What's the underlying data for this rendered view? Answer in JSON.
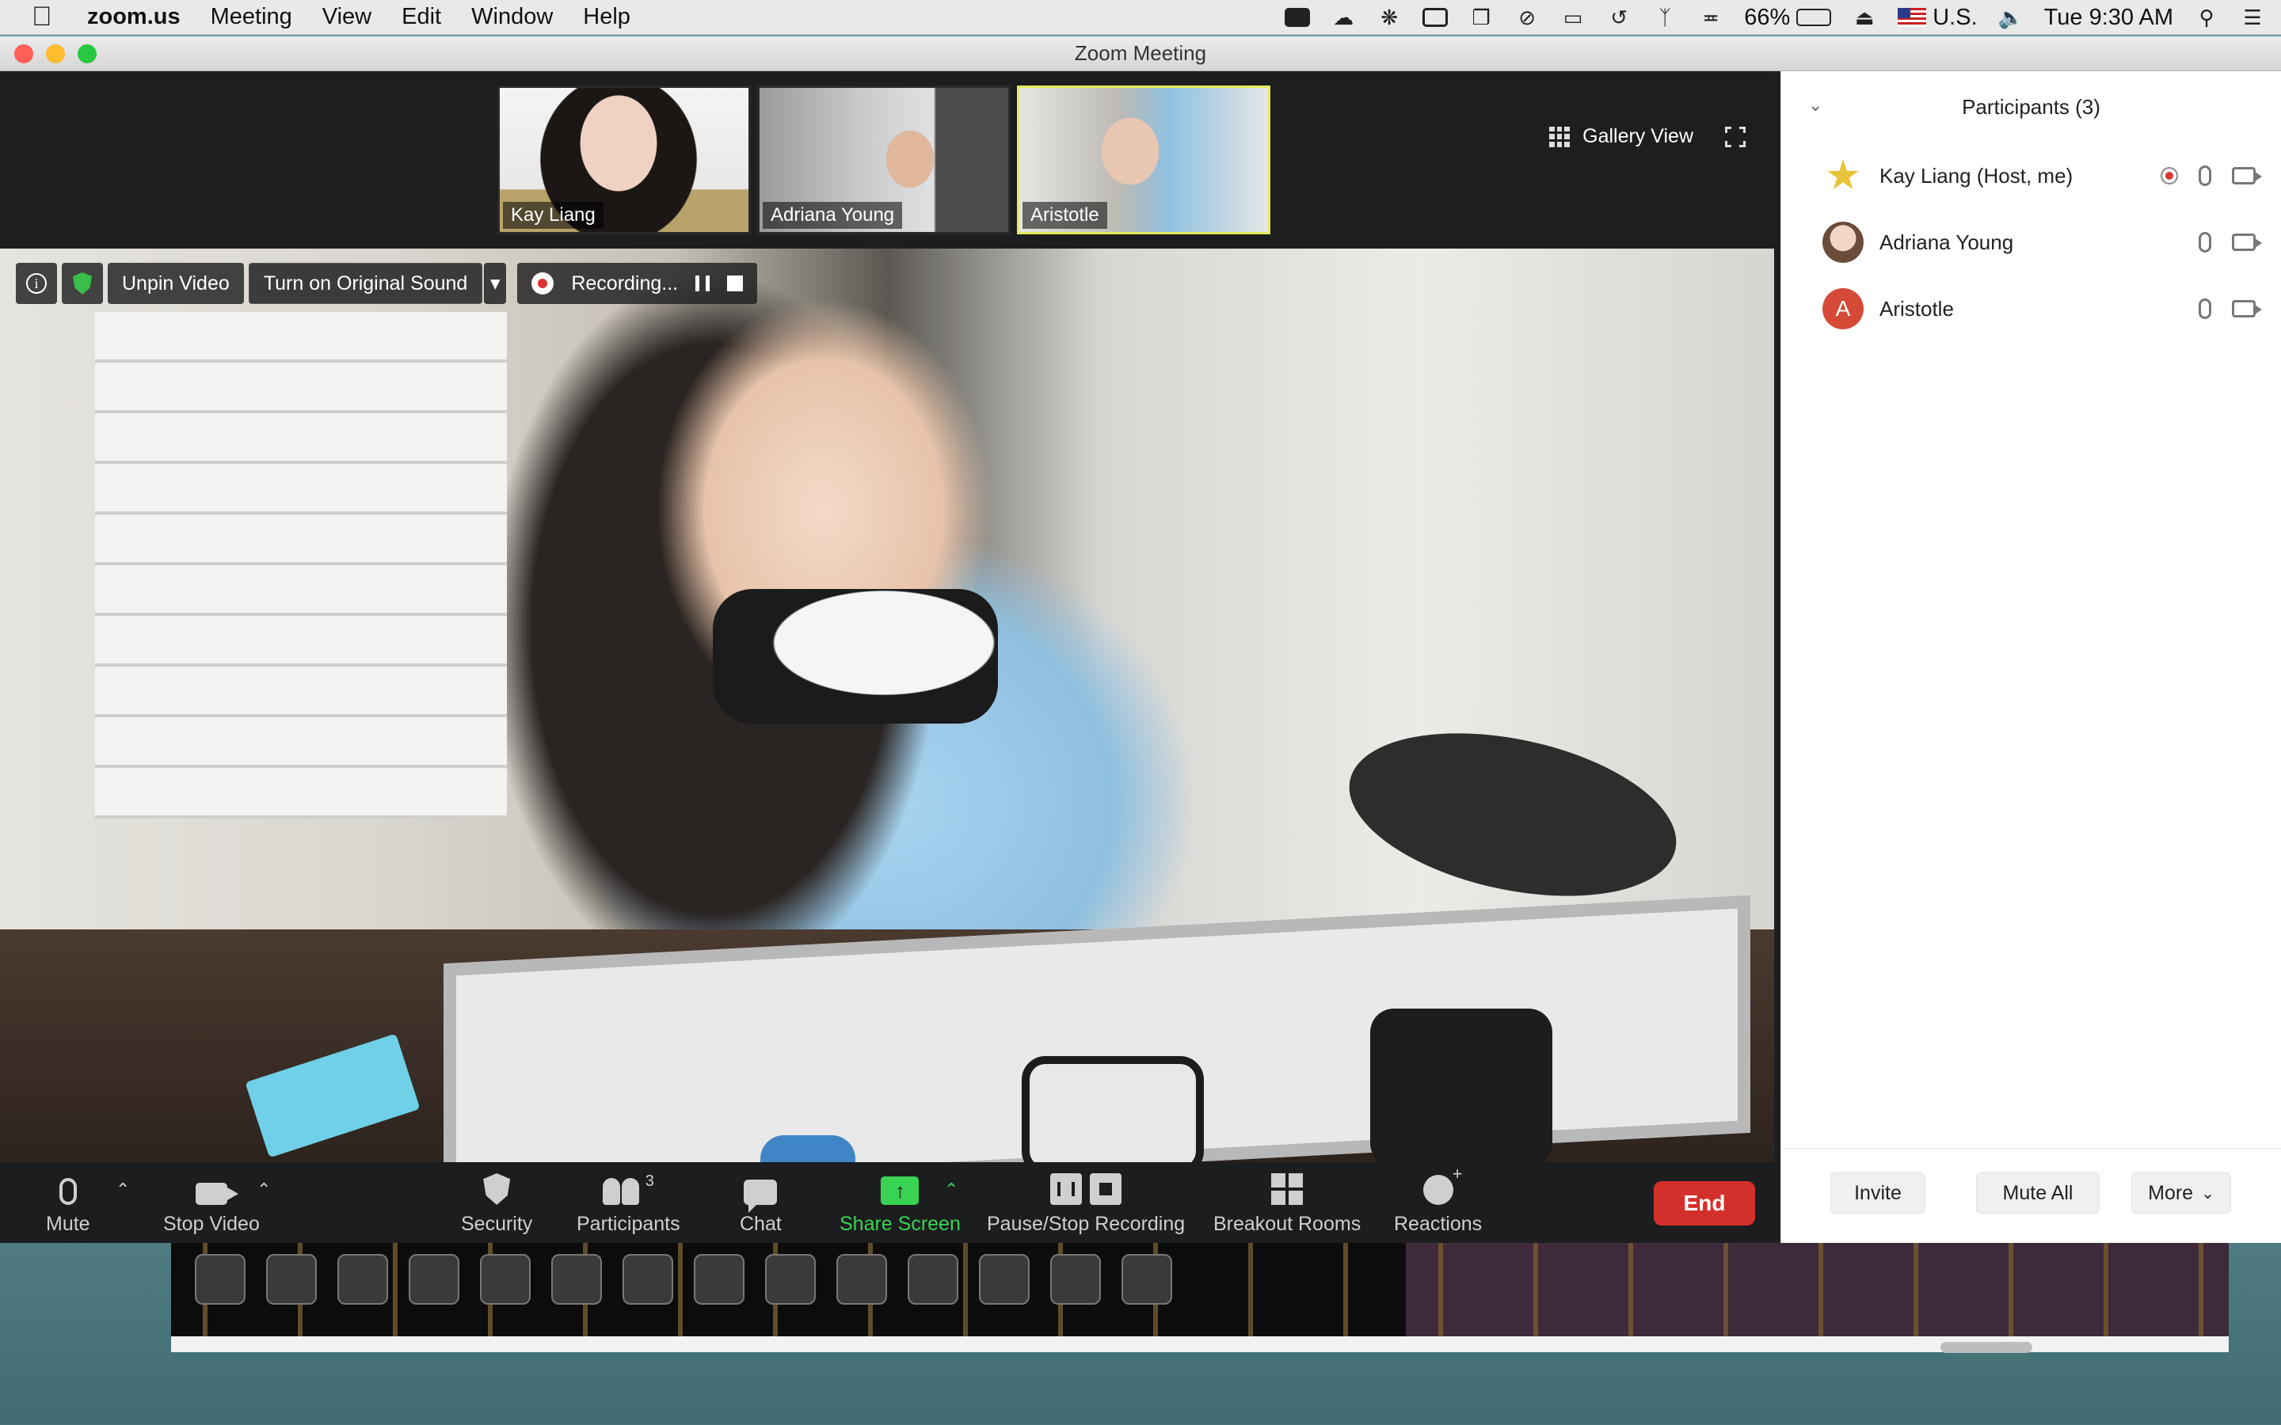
{
  "menubar": {
    "app": "zoom.us",
    "menus": [
      "Meeting",
      "View",
      "Edit",
      "Window",
      "Help"
    ],
    "battery": "66%",
    "battery_level": 0.66,
    "input_source": "U.S.",
    "clock": "Tue 9:30 AM"
  },
  "window": {
    "title": "Zoom Meeting"
  },
  "video": {
    "thumbnails": [
      {
        "name": "Kay Liang"
      },
      {
        "name": "Adriana Young"
      },
      {
        "name": "Aristotle"
      }
    ],
    "gallery_view": "Gallery View",
    "overlay": {
      "unpin": "Unpin Video",
      "original_sound": "Turn on Original Sound",
      "recording": "Recording..."
    }
  },
  "toolbar": {
    "mute": "Mute",
    "stop_video": "Stop Video",
    "security": "Security",
    "participants": "Participants",
    "participants_count": "3",
    "chat": "Chat",
    "share_screen": "Share Screen",
    "pause_stop_recording": "Pause/Stop Recording",
    "breakout_rooms": "Breakout Rooms",
    "reactions": "Reactions",
    "end": "End"
  },
  "participants_panel": {
    "title": "Participants (3)",
    "people": [
      {
        "name": "Kay Liang (Host, me)",
        "avatar": "star",
        "recording": true
      },
      {
        "name": "Adriana Young",
        "avatar": "photo",
        "recording": false
      },
      {
        "name": "Aristotle",
        "avatar": "A",
        "recording": false
      }
    ],
    "invite": "Invite",
    "mute_all": "Mute All",
    "more": "More"
  },
  "colors": {
    "share_green": "#39d353",
    "end_red": "#d4302b",
    "active_border": "#e5ea5c",
    "avatar_red": "#d44a36"
  }
}
